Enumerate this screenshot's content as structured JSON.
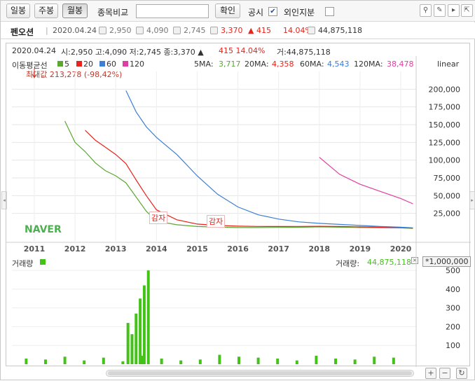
{
  "toolbar": {
    "tab_daily": "일봉",
    "tab_weekly": "주봉",
    "tab_monthly": "월봉",
    "compare_label": "종목비교",
    "confirm_button": "확인",
    "disclosure_label": "공시",
    "disclosure_checked": "✔",
    "foreign_label": "외인지분"
  },
  "info": {
    "name": "펜오션",
    "date": "2020.04.24",
    "open": "2,950",
    "high": "4,090",
    "low": "2,745",
    "close": "3,370",
    "change": "▲ 415",
    "change_pct": "14.04%",
    "volume": "44,875,118",
    "up_color": "#e8231b"
  },
  "chart_header": {
    "line1_date": "2020.04.24",
    "line1_ohlc": "시:2,950  고:4,090  저:2,745  종:3,370 ▲",
    "line1_change": "415  14.04%",
    "line1_volume": "거:44,875,118",
    "ma_title": "이동평균선",
    "ma_labels": [
      "5",
      "20",
      "60",
      "120"
    ],
    "ma_values_5": "3,717",
    "ma_values_20": "4,358",
    "ma_values_60": "4,543",
    "ma_values_120": "38,478",
    "ma5_label": "5MA:",
    "ma20_label": "20MA:",
    "ma60_label": "60MA:",
    "ma120_label": "120MA:",
    "scale_label": "linear",
    "max_label": "최대값 213,278 (-98,42%)",
    "watermark": "NAVER",
    "event_label": "감자"
  },
  "volume_header": {
    "title": "거래량",
    "right_label": "거래량:",
    "right_value": "44,875,118",
    "unit": "*1,000,000"
  },
  "colors": {
    "ma5": "#5aa832",
    "ma20": "#e8231b",
    "ma60": "#3b7fd6",
    "ma120": "#e03ea0",
    "up": "#e8231b",
    "down": "#2059c8",
    "volume": "#43c318"
  },
  "chart_data": [
    {
      "type": "line",
      "title": "",
      "x_ticks": [
        "2011",
        "2012",
        "2013",
        "2014",
        "2015",
        "2016",
        "2017",
        "2018",
        "2019",
        "2020"
      ],
      "y_ticks": [
        "200,000",
        "175,000",
        "150,000",
        "125,000",
        "100,000",
        "75,000",
        "50,000",
        "25,000"
      ],
      "ylim": [
        0,
        225000
      ],
      "scale": "linear",
      "x": [
        2010.75,
        2011.0,
        2011.25,
        2011.5,
        2011.75,
        2012.0,
        2012.25,
        2012.5,
        2012.75,
        2013.0,
        2013.25,
        2013.5,
        2013.75,
        2014.0,
        2014.5,
        2015.0,
        2015.5,
        2016.0,
        2016.5,
        2017.0,
        2017.5,
        2018.0,
        2018.5,
        2019.0,
        2019.5,
        2020.0,
        2020.3
      ],
      "series": [
        {
          "name": "5",
          "color": "#5aa832",
          "values": [
            null,
            null,
            null,
            null,
            155000,
            125000,
            112000,
            96000,
            85000,
            78000,
            68000,
            48000,
            28000,
            14000,
            9000,
            6500,
            5500,
            5000,
            5000,
            5200,
            5400,
            6000,
            5500,
            5000,
            4800,
            4500,
            3717
          ]
        },
        {
          "name": "20",
          "color": "#e8231b",
          "values": [
            null,
            null,
            null,
            null,
            null,
            null,
            142000,
            128000,
            118000,
            108000,
            95000,
            72000,
            50000,
            30000,
            16000,
            10000,
            8000,
            7000,
            6600,
            6500,
            6600,
            6800,
            6500,
            6000,
            5500,
            5000,
            4358
          ]
        },
        {
          "name": "60",
          "color": "#3b7fd6",
          "values": [
            null,
            null,
            null,
            null,
            null,
            null,
            null,
            null,
            null,
            null,
            198000,
            168000,
            147000,
            132000,
            108000,
            78000,
            52000,
            34000,
            23000,
            17000,
            13000,
            11000,
            9500,
            8000,
            6500,
            5500,
            4543
          ]
        },
        {
          "name": "120",
          "color": "#e03ea0",
          "values": [
            null,
            null,
            null,
            null,
            null,
            null,
            null,
            null,
            null,
            null,
            null,
            null,
            null,
            null,
            null,
            null,
            null,
            null,
            null,
            null,
            null,
            104000,
            80000,
            66000,
            56000,
            46000,
            38478
          ]
        }
      ],
      "price_max": {
        "x": 2011.0,
        "value": 213278
      }
    },
    {
      "type": "bar",
      "title": "거래량",
      "unit": "*1,000,000",
      "y_ticks": [
        "500",
        "400",
        "300",
        "200",
        "100"
      ],
      "ylim": [
        0,
        560
      ],
      "x": [
        2013.3,
        2013.4,
        2013.5,
        2013.6,
        2013.7,
        2013.8
      ],
      "values": [
        220,
        160,
        270,
        350,
        420,
        500
      ],
      "baseline_values": [
        30,
        25,
        40,
        20,
        35,
        15,
        45,
        30,
        20,
        25,
        50,
        40,
        35,
        30,
        20,
        45,
        30,
        25,
        40,
        35
      ]
    }
  ]
}
